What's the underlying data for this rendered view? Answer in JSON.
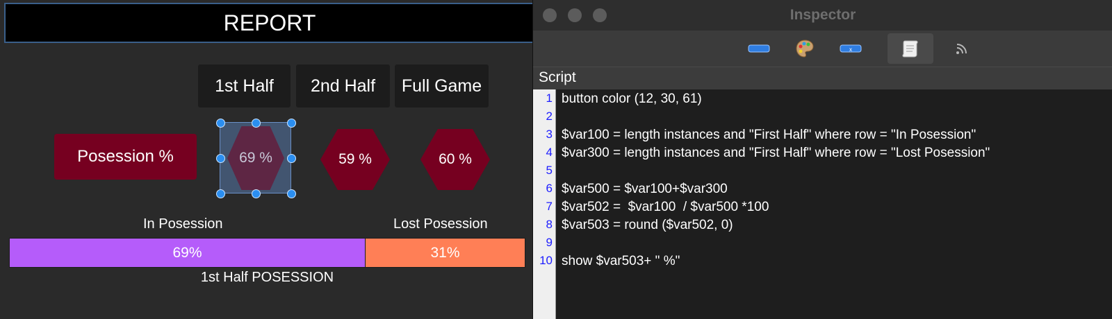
{
  "report": {
    "title": "REPORT",
    "periods": [
      "1st Half",
      "2nd Half",
      "Full Game"
    ],
    "metric_button": "Posession %",
    "hex_values": [
      "69 %",
      "59 %",
      "60 %"
    ],
    "bar": {
      "in_label": "In Posession",
      "lost_label": "Lost Posession",
      "in_percent": 69,
      "lost_percent": 31,
      "in_text": "69%",
      "lost_text": "31%",
      "caption": "1st Half POSESSION",
      "in_color": "#b55cfa",
      "lost_color": "#ff7f56"
    }
  },
  "inspector": {
    "title": "Inspector",
    "tab_icons": [
      "button-icon",
      "palette-icon",
      "variable-icon",
      "script-icon",
      "feed-icon"
    ],
    "active_tab": "script-icon",
    "section_label": "Script",
    "line_numbers": [
      "1",
      "2",
      "3",
      "4",
      "5",
      "6",
      "7",
      "8",
      "9",
      "10"
    ],
    "code_lines": [
      "button color (12, 30, 61)",
      "",
      "$var100 = length instances and \"First Half\" where row = \"In Posession\"",
      "$var300 = length instances and \"First Half\" where row = \"Lost Posession\"",
      "",
      "$var500 = $var100+$var300",
      "$var502 =  $var100  / $var500 *100",
      "$var503 = round ($var502, 0)",
      "",
      "show $var503+ \" %\""
    ]
  },
  "colors": {
    "accent": "#760020",
    "selection": "#2b8ef0",
    "line_number": "#1d1dff"
  }
}
